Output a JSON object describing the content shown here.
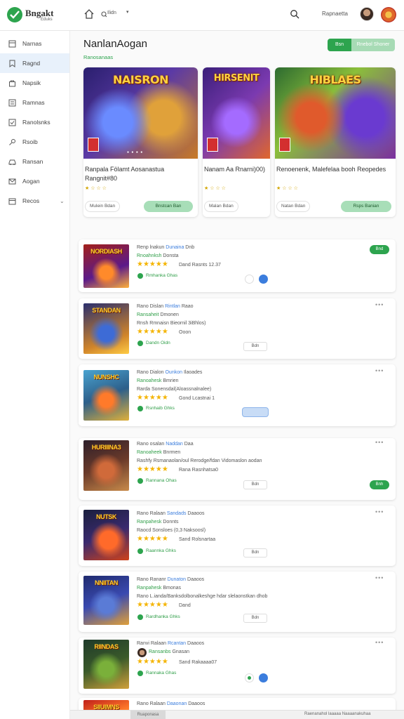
{
  "header": {
    "brand": "Bngakt",
    "brand_sub": "Eduks",
    "search_text": "Ilidn",
    "user_name": "Rapnaetta"
  },
  "sidebar": {
    "items": [
      {
        "label": "Narnas",
        "icon": "inbox-icon"
      },
      {
        "label": "Ragnd",
        "icon": "bookmark-icon",
        "active": true
      },
      {
        "label": "Napsik",
        "icon": "bag-icon"
      },
      {
        "label": "Ramnas",
        "icon": "tray-icon"
      },
      {
        "label": "Ranolsnks",
        "icon": "checkbox-icon"
      },
      {
        "label": "Rsoib",
        "icon": "key-icon"
      },
      {
        "label": "Ransan",
        "icon": "car-icon"
      },
      {
        "label": "Aogan",
        "icon": "mail-icon"
      },
      {
        "label": "Recos",
        "icon": "calendar-icon",
        "expandable": true
      }
    ]
  },
  "main": {
    "title": "NanlanAogan",
    "subtitle": "Ranosanaas",
    "btn_primary": "Bsn",
    "btn_secondary": "Rnebol Shoner"
  },
  "featured": [
    {
      "image_title": "NAISRON",
      "title": "Ranpala Fölamt Aosanastua Rangnit#80",
      "rating": "★ ☆ ☆ ☆",
      "btn_left": "Mulein Bdan",
      "btn_right": "Bnstcan Ban",
      "colors": [
        "#3a2d86",
        "#d9882a"
      ]
    },
    {
      "image_title": "HIRSENIT",
      "title": "Nanam Aa Rnarni)00)",
      "rating": "★ ☆ ☆ ☆",
      "btn_left": "Malan Bdan",
      "btn_right": "",
      "colors": [
        "#5b2b8e",
        "#e05a2c"
      ]
    },
    {
      "image_title": "HIBLAES",
      "title": "Renoenenk, Malefelaa booh Reopedes",
      "rating": "★ ☆ ☆ ☆",
      "btn_left": "Natan Bdan",
      "btn_right": "Rsps Banian",
      "colors": [
        "#2e6d3a",
        "#7b2fa0"
      ]
    }
  ],
  "list": [
    {
      "image_title": "NORDIASH",
      "line1_a": "Renp lnakun",
      "line1_b": "Dunaina",
      "line1_c": "Dnb",
      "line2": "Rnoahnksh",
      "line2_b": "Donsta",
      "line3": "",
      "stars_text": "Dand Rasnts 12.37",
      "meta": "Rmhanka Ghas",
      "pill": "Bnd",
      "buttons": [
        "gray-round",
        "blue-round"
      ]
    },
    {
      "image_title": "STANDAN",
      "line1_a": "Rano Dislan",
      "line1_b": "Rintlan",
      "line1_c": "Raao",
      "line2": "Ransaheit",
      "line2_b": "Dmonen",
      "line3": "Rnsh Rmnaisn Bieornil 3iBhlos)",
      "stars_text": "Ooon",
      "meta": "Dandn Oidn",
      "pill": "",
      "buttons": [
        "Bdn"
      ]
    },
    {
      "image_title": "NUNSHC",
      "line1_a": "Rano Dialon",
      "line1_b": "Ounkon",
      "line1_c": "Ilaoades",
      "line2": "Ranoahesk",
      "line2_b": "Bmrien",
      "line3": "Rarda Sonensdal(Aloassnalnalee)",
      "stars_text": "Gond Lcastnai 1",
      "meta": "Rsnhaib Ghks",
      "pill": "",
      "buttons": [
        "blue"
      ]
    },
    {
      "image_title": "HURIIINA3",
      "line1_a": "Rano osalan",
      "line1_b": "Naddan",
      "line1_c": "Daa",
      "line2": "Ranoaheek",
      "line2_b": "Bnrmen",
      "line3": "Rashfy Rsmanaolan/oul Rerodge/fdan Vidomaslon aodan",
      "stars_text": "Rana Rasnhatsa0",
      "meta": "Rannana Ohas",
      "pill": "Bnh",
      "buttons": [
        "Bdn"
      ]
    },
    {
      "image_title": "NUTSK",
      "line1_a": "Rano Ralaan",
      "line1_b": "Sandads",
      "line1_c": "Daaoos",
      "line2": "Ranpahesk",
      "line2_b": "Donnts",
      "line3": "Raocd Sonsloes (0,3 Naksoosl)",
      "stars_text": "Sand Rolsnartaa",
      "meta": "Raannka Ghks",
      "pill": "",
      "buttons": [
        "Bdn"
      ]
    },
    {
      "image_title": "NNIITAN",
      "line1_a": "Rano Rananr",
      "line1_b": "Dunaton",
      "line1_c": "Daaoos",
      "line2": "Ranpahesk",
      "line2_b": "Bmonas",
      "line3": "Rano L.ianda/Banksdolbonalkeshge hdar slelaonstkan dhob",
      "stars_text": "Dand",
      "meta": "Rardhanka Ghks",
      "pill": "",
      "buttons": [
        "Bdn"
      ]
    },
    {
      "image_title": "RIINDAS",
      "line1_a": "Ranvi Ralaan",
      "line1_b": "Rcantan",
      "line1_c": "Daaoos",
      "line2": "Ransanbs",
      "line2_b": "Gnasan",
      "line3": "",
      "stars_text": "Sand Rakaaaa07",
      "meta": "Rannaka Ghas",
      "pill": "",
      "buttons": [
        "green-round",
        "blue-round"
      ]
    },
    {
      "image_title": "SIIUIMNS",
      "line1_a": "Rano Ralaan",
      "line1_b": "Daaonan",
      "line1_c": "Daaoos",
      "line2": "",
      "line2_b": "",
      "line3": "",
      "stars_text": "",
      "meta": "",
      "pill": "",
      "buttons": []
    }
  ],
  "status_bar": {
    "tab": "Ruaponasa",
    "right": "Raenanahol laaaaa Naaaanakuhaa"
  }
}
